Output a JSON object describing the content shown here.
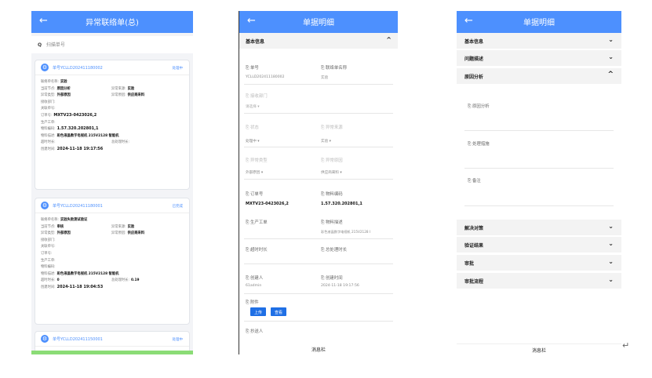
{
  "p1": {
    "back": "←",
    "title": "异常联络单(总)",
    "search_icon": "Q",
    "search_placeholder": "扫描单号",
    "gear": "⚙",
    "cards": [
      {
        "no": "单号YCLLD202411180002",
        "status": "处理中",
        "status_color": "#4d90fe",
        "rows": [
          {
            "k": "联络单名称:",
            "v": "实验"
          },
          {
            "k": "当前节点:",
            "v": "原因分析",
            "k2": "异常来源:",
            "v2": "实验"
          },
          {
            "k": "异常类型:",
            "v": "外部原因",
            "k2": "异常原因:",
            "v2": "供应商来料"
          },
          {
            "k": "接收部门:",
            "v": ""
          },
          {
            "k": "关联单号:",
            "v": ""
          },
          {
            "k": "订单号:",
            "v": "MXTV23-0423026,2",
            "big": true
          },
          {
            "k": "生产工单:",
            "v": ""
          },
          {
            "k": "物料编码:",
            "v": "1.57.320.202801,1",
            "big": true
          },
          {
            "k": "物料描述:",
            "v": "彩色液晶数字电视机 215V2128 智能机"
          },
          {
            "k": "超时时长:",
            "v": "",
            "k2": "总处理时长:",
            "v2": ""
          },
          {
            "k": "创建时间:",
            "v": "2024-11-18 19:17:56",
            "big": true
          }
        ]
      },
      {
        "no": "单号YCLLD202411180001",
        "status": "已完成",
        "status_color": "#4d90fe",
        "rows": [
          {
            "k": "联络单名称:",
            "v": "实验失败测试验证"
          },
          {
            "k": "当前节点:",
            "v": "审核",
            "k2": "异常来源:",
            "v2": "实验"
          },
          {
            "k": "异常类型:",
            "v": "外部原因",
            "k2": "异常原因:",
            "v2": "供应商来料"
          },
          {
            "k": "接收部门:",
            "v": ""
          },
          {
            "k": "关联单号:",
            "v": ""
          },
          {
            "k": "订单号:",
            "v": ""
          },
          {
            "k": "生产工单:",
            "v": ""
          },
          {
            "k": "物料编码:",
            "v": ""
          },
          {
            "k": "物料描述:",
            "v": "彩色液晶数字电视机 215V2128 智能机"
          },
          {
            "k": "超时时长:",
            "v": "0",
            "k2": "总处理时长:",
            "v2": "0.19"
          },
          {
            "k": "创建时间:",
            "v": "2024-11-18 19:04:53",
            "big": true
          }
        ]
      },
      {
        "no": "单号YCLLD202411150001",
        "status": "处理中",
        "status_color": "#4d90fe",
        "rows": []
      }
    ]
  },
  "p2": {
    "back": "←",
    "title": "单据明细",
    "section": "基本信息",
    "section_arrow": "^",
    "fields": {
      "no_label": "单号",
      "no_value": "YCLLD202411180002",
      "name_label": "联络单名称",
      "name_value": "实验",
      "dept_label": "接收部门",
      "dept_value": "请选择 ▾",
      "state_label": "状态",
      "state_value": "处理中 ▾",
      "src_label": "异常来源",
      "src_value": "实验 ▾",
      "type_label": "异常类型",
      "type_value": "外部原因 ▾",
      "reason_label": "异常原因",
      "reason_value": "供应商来料 ▾",
      "order_label": "订单号",
      "order_value": "MXTV23-0423026,2",
      "mat_label": "物料编码",
      "mat_value": "1.57.320.202801,1",
      "wo_label": "生产工单",
      "desc_label": "物料描述",
      "desc_value": "彩色液晶数字电视机 215V2128 I",
      "timeout_label": "超时时长",
      "total_label": "总处理时长",
      "creator_label": "创建人",
      "creator_value": "61admin",
      "ctime_label": "创建时间",
      "ctime_value": "2024-11-18 19:17:56",
      "attach_label": "附件",
      "cc_label": "抄送人"
    },
    "upload": "上传",
    "view": "查看",
    "footer": "消息栏"
  },
  "p3": {
    "back": "←",
    "title": "单据明细",
    "sections": [
      "基本信息",
      "问题描述",
      "原因分析"
    ],
    "reason_fields": [
      "原因分析",
      "处理措施",
      "备注"
    ],
    "sections2": [
      "解决对策",
      "验证结果",
      "审批",
      "审批流程"
    ],
    "footer": "消息栏"
  },
  "enter_icon": "↵"
}
